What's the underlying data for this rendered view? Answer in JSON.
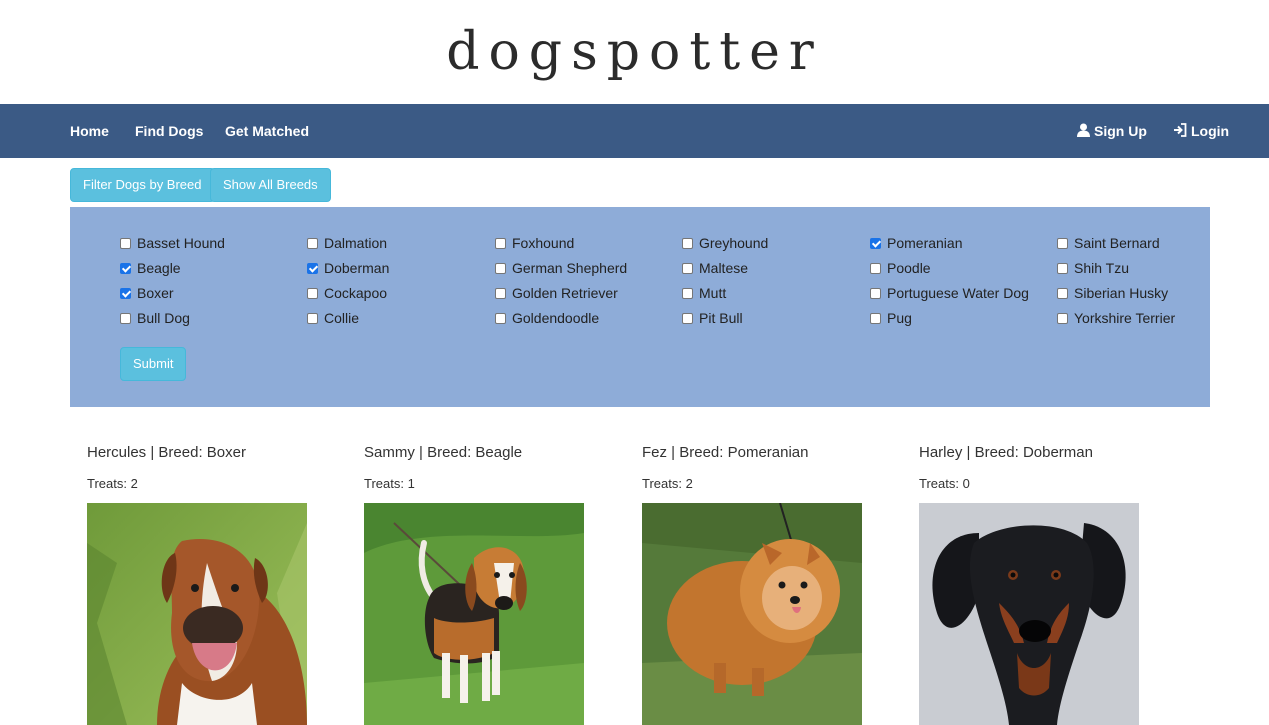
{
  "brand": {
    "title": "dogspotter"
  },
  "nav": {
    "left": [
      {
        "label": "Home"
      },
      {
        "label": "Find Dogs"
      },
      {
        "label": "Get Matched"
      }
    ],
    "right": [
      {
        "label": "Sign Up",
        "icon": "user-icon"
      },
      {
        "label": "Login",
        "icon": "login-icon"
      }
    ]
  },
  "actions": {
    "filter_label": "Filter Dogs by Breed",
    "show_all_label": "Show All Breeds"
  },
  "filter": {
    "columns": [
      [
        {
          "label": "Basset Hound",
          "checked": false
        },
        {
          "label": "Beagle",
          "checked": true
        },
        {
          "label": "Boxer",
          "checked": true
        },
        {
          "label": "Bull Dog",
          "checked": false
        }
      ],
      [
        {
          "label": "Dalmation",
          "checked": false
        },
        {
          "label": "Doberman",
          "checked": true
        },
        {
          "label": "Cockapoo",
          "checked": false
        },
        {
          "label": "Collie",
          "checked": false
        }
      ],
      [
        {
          "label": "Foxhound",
          "checked": false
        },
        {
          "label": "German Shepherd",
          "checked": false
        },
        {
          "label": "Golden Retriever",
          "checked": false
        },
        {
          "label": "Goldendoodle",
          "checked": false
        }
      ],
      [
        {
          "label": "Greyhound",
          "checked": false
        },
        {
          "label": "Maltese",
          "checked": false
        },
        {
          "label": "Mutt",
          "checked": false
        },
        {
          "label": "Pit Bull",
          "checked": false
        }
      ],
      [
        {
          "label": "Pomeranian",
          "checked": true
        },
        {
          "label": "Poodle",
          "checked": false
        },
        {
          "label": "Portuguese Water Dog",
          "checked": false
        },
        {
          "label": "Pug",
          "checked": false
        }
      ],
      [
        {
          "label": "Saint Bernard",
          "checked": false
        },
        {
          "label": "Shih Tzu",
          "checked": false
        },
        {
          "label": "Siberian Husky",
          "checked": false
        },
        {
          "label": "Yorkshire Terrier",
          "checked": false
        }
      ]
    ],
    "submit_label": "Submit"
  },
  "dogs": [
    {
      "title": "Hercules | Breed: Boxer",
      "treats": "Treats: 2",
      "photo": "boxer-photo"
    },
    {
      "title": "Sammy | Breed: Beagle",
      "treats": "Treats: 1",
      "photo": "beagle-photo"
    },
    {
      "title": "Fez | Breed: Pomeranian",
      "treats": "Treats: 2",
      "photo": "pomeranian-photo"
    },
    {
      "title": "Harley | Breed: Doberman",
      "treats": "Treats: 0",
      "photo": "doberman-photo"
    }
  ],
  "colors": {
    "navbar": "#3b5a85",
    "panel": "#8eacd8",
    "button": "#5bc0de",
    "checkbox_checked": "#1a73e8"
  }
}
